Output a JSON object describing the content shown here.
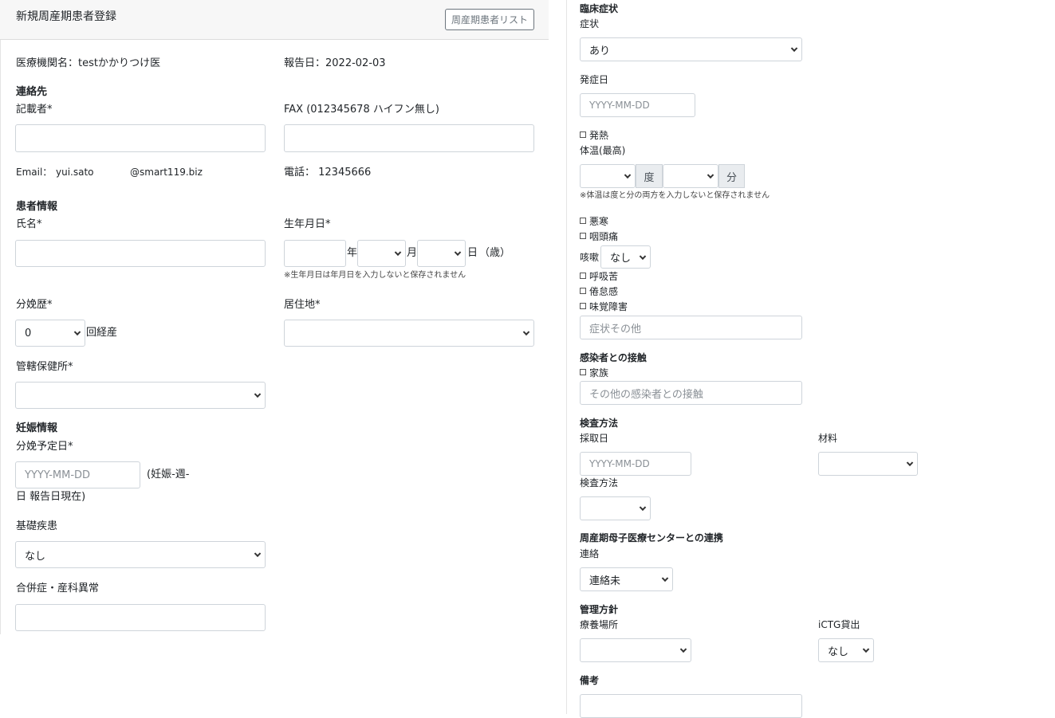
{
  "header": {
    "title": "新規周産期患者登録",
    "list_button": "周産期患者リスト"
  },
  "left": {
    "facility": "医療機関名：testかかりつけ医",
    "report_date": "報告日：2022-02-03",
    "contact_heading": "連絡先",
    "writer_label": "記載者*",
    "fax_label": "FAX (012345678 ハイフン無し)",
    "email_label": "Email：",
    "email_user": "yui.sato",
    "email_domain": "@smart119.biz",
    "phone": "電話： 12345666",
    "patient_heading": "患者情報",
    "name_label": "氏名*",
    "birth_label": "生年月日*",
    "year_suffix": "年",
    "month_suffix": "月",
    "day_suffix": "日",
    "age_text": "（歳）",
    "birth_note": "※生年月日は年月日を入力しないと保存されません",
    "parity_label": "分娩歴*",
    "parity_value": "0",
    "parity_suffix": "回経産",
    "residence_label": "居住地*",
    "health_center_label": "管轄保健所*",
    "pregnancy_heading": "妊娠情報",
    "due_date_label": "分娩予定日*",
    "due_date_placeholder": "YYYY-MM-DD",
    "gestation_text_1": "(妊娠-週-",
    "gestation_text_2": "日 報告日現在)",
    "underlying_label": "基礎疾患",
    "underlying_value": "なし",
    "complication_label": "合併症・産科異常"
  },
  "right": {
    "clinical_heading": "臨床症状",
    "symptom_label": "症状",
    "symptom_value": "あり",
    "onset_label": "発症日",
    "onset_placeholder": "YYYY-MM-DD",
    "fever_label": "発熱",
    "temp_label": "体温(最高)",
    "degree_label": "度",
    "minute_label": "分",
    "temp_note": "※体温は度と分の両方を入力しないと保存されません",
    "chills_label": "悪寒",
    "sore_throat_label": "咽頭痛",
    "cough_label": "咳嗽",
    "cough_value": "なし",
    "dyspnea_label": "呼吸苦",
    "fatigue_label": "倦怠感",
    "taste_label": "味覚障害",
    "other_symptom_placeholder": "症状その他",
    "contact_heading": "感染者との接触",
    "family_label": "家族",
    "other_contact_placeholder": "その他の感染者との接触",
    "test_heading": "検査方法",
    "sample_date_label": "採取日",
    "sample_date_placeholder": "YYYY-MM-DD",
    "material_label": "材料",
    "test_method_label": "検査方法",
    "center_heading": "周産期母子医療センターとの連携",
    "liaison_label": "連絡",
    "liaison_value": "連絡未",
    "policy_heading": "管理方針",
    "care_place_label": "療養場所",
    "ictg_label": "iCTG貸出",
    "ictg_value": "なし",
    "remarks_heading": "備考"
  }
}
